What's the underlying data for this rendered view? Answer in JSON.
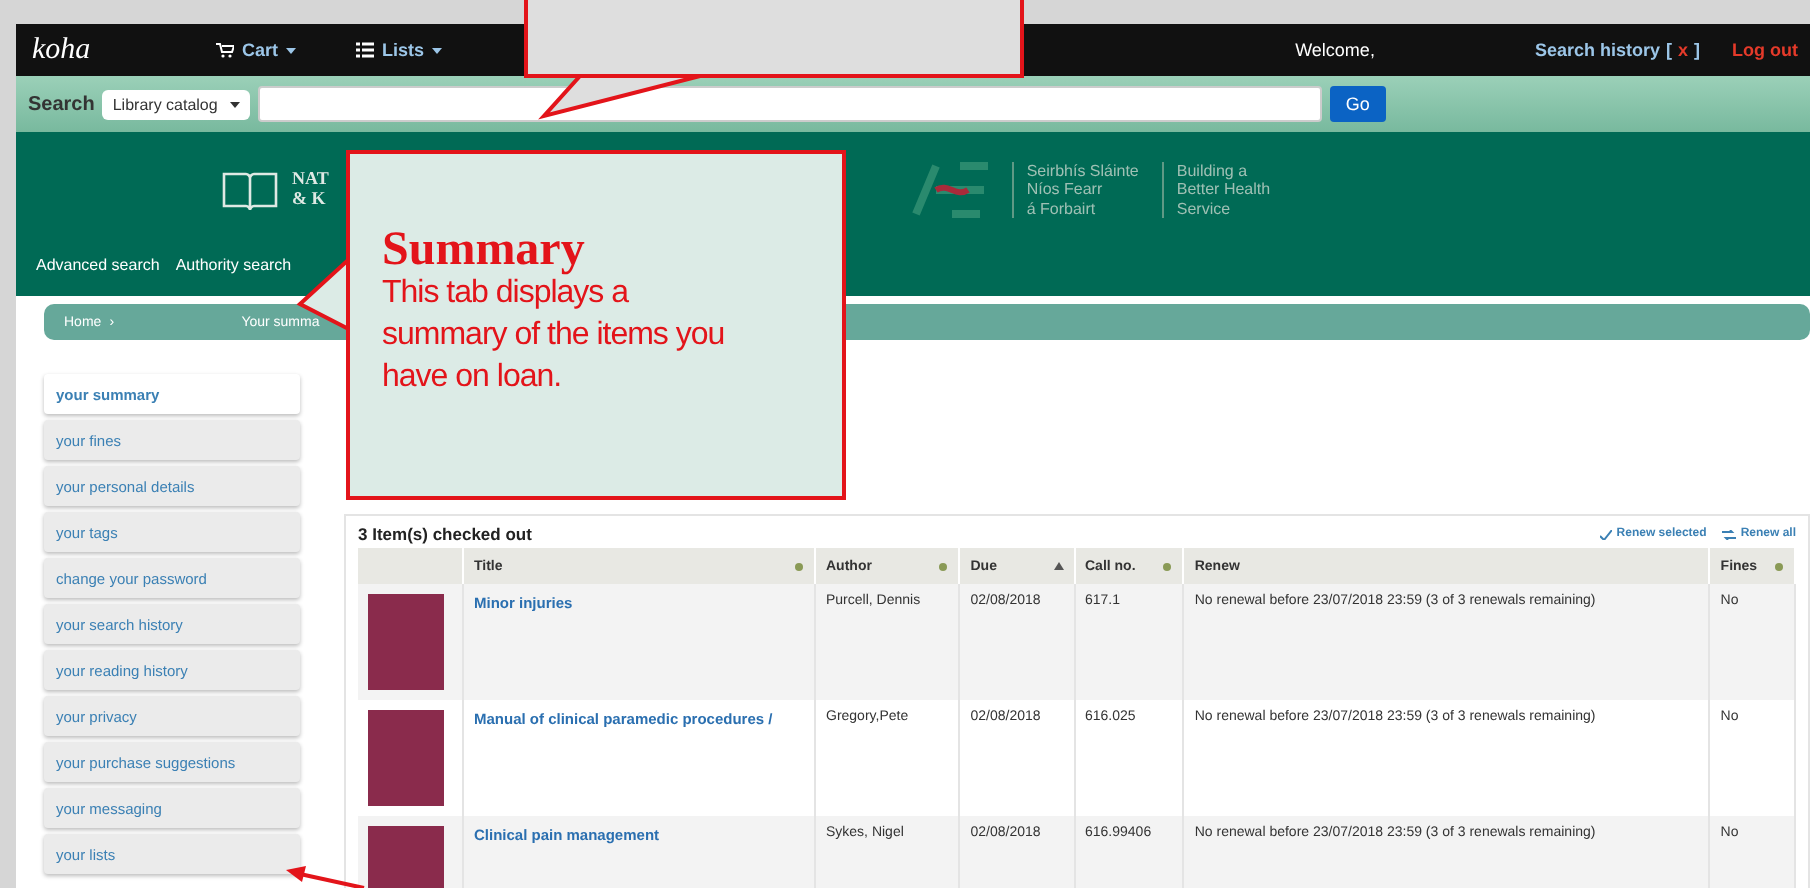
{
  "topbar": {
    "logo": "koha",
    "menus": [
      "Cart",
      "Lists"
    ],
    "welcome": "Welcome,",
    "search_history": "Search history",
    "bracket_open": "[",
    "clear": "x",
    "bracket_close": "]",
    "logout": "Log out"
  },
  "search": {
    "label": "Search",
    "scope": "Library catalog",
    "button": "Go"
  },
  "header": {
    "library_line_1": "NAT",
    "library_line_2": "& K",
    "hse_col_1": [
      "Seirbhís Sláinte",
      "Níos Fearr",
      "á Forbairt"
    ],
    "hse_col_2": [
      "Building a",
      "Better Health",
      "Service"
    ],
    "links": [
      "Advanced search",
      "Authority search"
    ]
  },
  "breadcrumb": {
    "home": "Home",
    "separator": "›",
    "current": "Your summa"
  },
  "sidebar": [
    {
      "label": "your summary",
      "selected": true
    },
    {
      "label": "your fines",
      "selected": false
    },
    {
      "label": "your personal details",
      "selected": false
    },
    {
      "label": "your tags",
      "selected": false
    },
    {
      "label": "change your password",
      "selected": false
    },
    {
      "label": "your search history",
      "selected": false
    },
    {
      "label": "your reading history",
      "selected": false
    },
    {
      "label": "your privacy",
      "selected": false
    },
    {
      "label": "your purchase suggestions",
      "selected": false
    },
    {
      "label": "your messaging",
      "selected": false
    },
    {
      "label": "your lists",
      "selected": false
    }
  ],
  "table": {
    "caption": "3 Item(s) checked out",
    "actions": [
      "Renew selected",
      "Renew all"
    ],
    "columns": [
      {
        "label": "Title",
        "kind": "sortable"
      },
      {
        "label": "Author",
        "kind": "sortable"
      },
      {
        "label": "Due",
        "kind": "sorted"
      },
      {
        "label": "Call no.",
        "kind": "sortable"
      },
      {
        "label": "Renew",
        "kind": "plain"
      },
      {
        "label": "Fines",
        "kind": "sortable"
      }
    ],
    "rows": [
      {
        "title": "Minor injuries",
        "author": "Purcell, Dennis",
        "due": "02/08/2018",
        "call_no": "617.1",
        "renew": "No renewal before 23/07/2018 23:59 (3 of 3 renewals remaining)",
        "fines": "No"
      },
      {
        "title": "Manual of clinical paramedic procedures /",
        "author": "Gregory,Pete",
        "due": "02/08/2018",
        "call_no": "616.025",
        "renew": "No renewal before 23/07/2018 23:59 (3 of 3 renewals remaining)",
        "fines": "No"
      },
      {
        "title": "Clinical pain management",
        "author": "Sykes, Nigel",
        "due": "02/08/2018",
        "call_no": "616.99406",
        "renew": "No renewal before 23/07/2018 23:59 (3 of 3 renewals remaining)",
        "fines": "No"
      }
    ]
  },
  "callout": {
    "title": "Summary",
    "text": "This tab displays a summary of the items you have on loan."
  }
}
